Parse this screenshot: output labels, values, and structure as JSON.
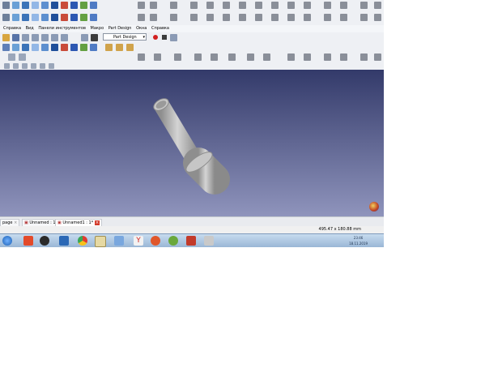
{
  "menu": {
    "items": [
      "Справка",
      "Вид",
      "Панели инструментов",
      "Макро",
      "Part Design",
      "Окна",
      "Справка"
    ]
  },
  "workbench": {
    "selected": "Part Design"
  },
  "document_tabs": {
    "items": [
      "page",
      "Unnamed : 1*",
      "Unnamed1 : 1*"
    ]
  },
  "status_bar": {
    "dimensions": "495.47 x 180.88 mm"
  },
  "taskbar": {
    "time": "23:46",
    "date": "18.11.2019"
  },
  "colors": {
    "viewport_top": "#333a6a",
    "viewport_bottom": "#8f94bc",
    "toolbar_bg": "#eef0f4",
    "taskbar_bg": "#a9c4e0",
    "model_gray": "#b8b8b8",
    "record_red": "#d22020"
  },
  "icons": [
    "folder-icon",
    "save-icon",
    "cube-view-icon",
    "axis-view-icon",
    "sketch-icon",
    "measure-icon",
    "record-icon",
    "stop-icon",
    "close-icon",
    "freecad-3d-icon",
    "start-icon",
    "browser-icon",
    "mail-icon",
    "chrome-icon",
    "paint-icon"
  ]
}
